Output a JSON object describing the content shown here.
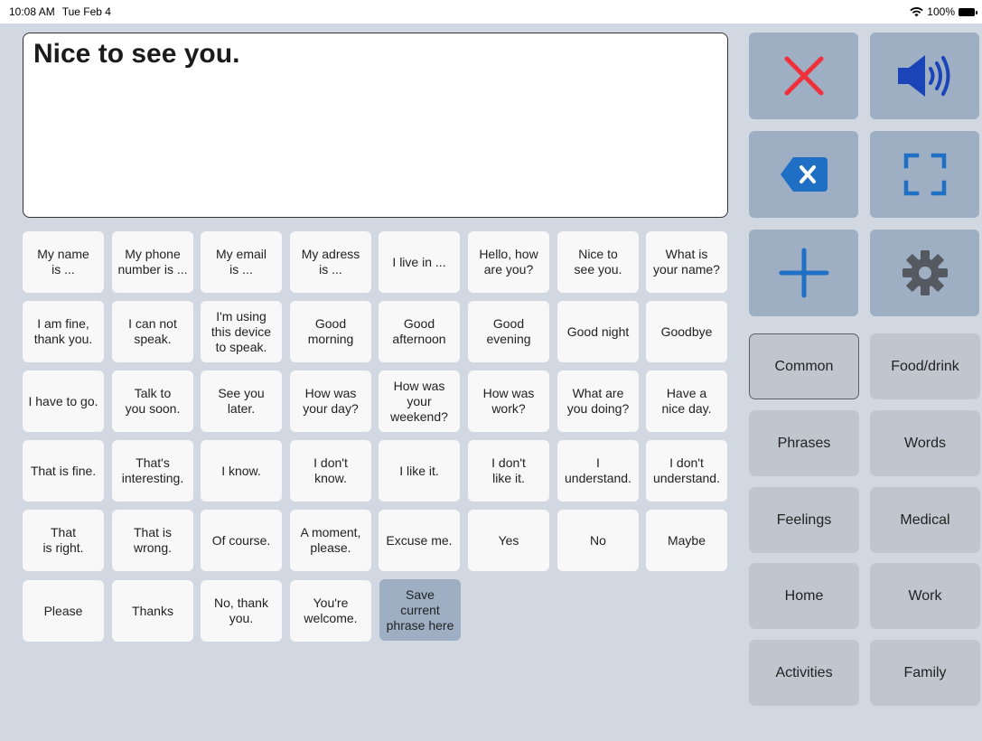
{
  "status": {
    "time": "10:08 AM",
    "date": "Tue Feb 4",
    "battery": "100%"
  },
  "output": {
    "text": "Nice to see you."
  },
  "phrases": [
    "My name\nis ...",
    "My phone\nnumber is ...",
    "My email\nis ...",
    "My adress\nis ...",
    "I live in ...",
    "Hello, how\nare you?",
    "Nice to\nsee you.",
    "What is\nyour name?",
    "I am fine,\nthank you.",
    "I can not\nspeak.",
    "I'm using\nthis device\nto speak.",
    "Good\nmorning",
    "Good\nafternoon",
    "Good\nevening",
    "Good night",
    "Goodbye",
    "I have to go.",
    "Talk to\nyou soon.",
    "See you\nlater.",
    "How was\nyour day?",
    "How was\nyour\nweekend?",
    "How was\nwork?",
    "What are\nyou doing?",
    "Have a\nnice day.",
    "That is fine.",
    "That's\ninteresting.",
    "I know.",
    "I don't\nknow.",
    "I like it.",
    "I don't\nlike it.",
    "I\nunderstand.",
    "I don't\nunderstand.",
    "That\nis right.",
    "That is\nwrong.",
    "Of course.",
    "A moment,\nplease.",
    "Excuse me.",
    "Yes",
    "No",
    "Maybe",
    "Please",
    "Thanks",
    "No, thank\nyou.",
    "You're\nwelcome."
  ],
  "save_button": {
    "label": "Save\ncurrent\nphrase here"
  },
  "toolbar": {
    "clear_icon": "close-icon",
    "speak_icon": "speaker-icon",
    "delete_icon": "backspace-icon",
    "fullscreen_icon": "fullscreen-icon",
    "add_icon": "plus-icon",
    "settings_icon": "gear-icon",
    "accent_blue": "#1a44b8",
    "accent_red": "#f0303a"
  },
  "categories": [
    "Common",
    "Food/drink",
    "Phrases",
    "Words",
    "Feelings",
    "Medical",
    "Home",
    "Work",
    "Activities",
    "Family"
  ],
  "selected_category": "Common"
}
